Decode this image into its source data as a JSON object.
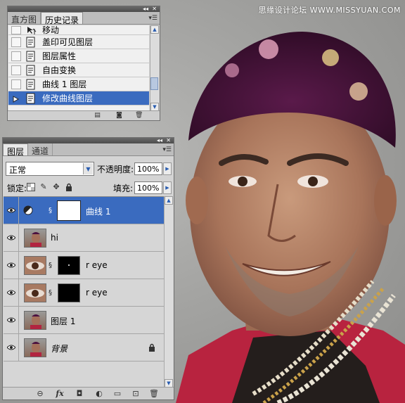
{
  "watermark": "思缘设计论坛  WWW.MISSYUAN.COM",
  "history_panel": {
    "tabs": [
      {
        "label": "直方图",
        "active": false
      },
      {
        "label": "历史记录",
        "active": true
      }
    ],
    "items": [
      {
        "label": "移动",
        "selected": false
      },
      {
        "label": "盖印可见图层",
        "selected": false
      },
      {
        "label": "图层属性",
        "selected": false
      },
      {
        "label": "自由变换",
        "selected": false
      },
      {
        "label": "曲线 1 图层",
        "selected": false
      },
      {
        "label": "修改曲线图层",
        "selected": true
      }
    ]
  },
  "layers_panel": {
    "tabs": [
      {
        "label": "图层",
        "active": true
      },
      {
        "label": "通道",
        "active": false
      }
    ],
    "blend_mode": "正常",
    "opacity_label": "不透明度:",
    "opacity_value": "100%",
    "lock_label": "锁定:",
    "fill_label": "填充:",
    "fill_value": "100%",
    "layers": [
      {
        "name": "曲线 1",
        "type": "adjustment",
        "selected": true
      },
      {
        "name": "hi",
        "type": "image",
        "selected": false
      },
      {
        "name": "r eye",
        "type": "eye-masked",
        "selected": false
      },
      {
        "name": "r eye",
        "type": "eye-masked",
        "selected": false
      },
      {
        "name": "图层 1",
        "type": "image",
        "selected": false
      },
      {
        "name": "背景",
        "type": "background",
        "selected": false,
        "locked": true
      }
    ]
  },
  "colors": {
    "selection": "#3a6bbf",
    "panel_bg": "#d4d4d4",
    "panel_header": "#4c4c4c"
  }
}
